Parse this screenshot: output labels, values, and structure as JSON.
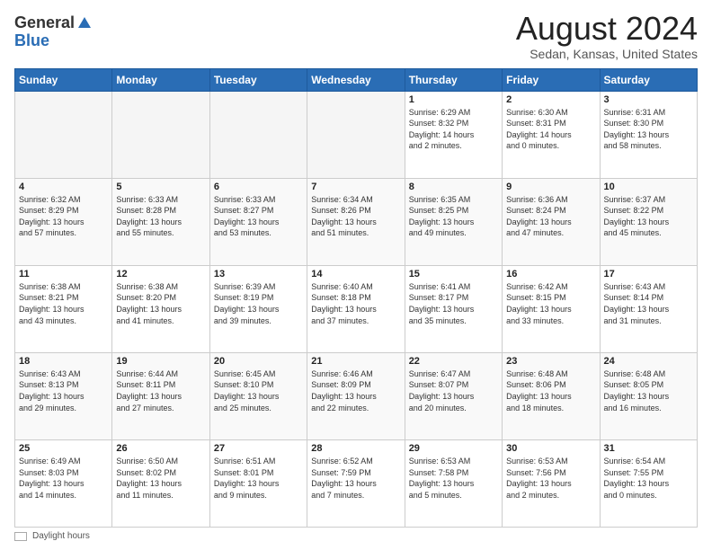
{
  "header": {
    "logo_general": "General",
    "logo_blue": "Blue",
    "month_title": "August 2024",
    "location": "Sedan, Kansas, United States"
  },
  "weekdays": [
    "Sunday",
    "Monday",
    "Tuesday",
    "Wednesday",
    "Thursday",
    "Friday",
    "Saturday"
  ],
  "footer": {
    "label": "Daylight hours"
  },
  "weeks": [
    [
      {
        "day": "",
        "info": ""
      },
      {
        "day": "",
        "info": ""
      },
      {
        "day": "",
        "info": ""
      },
      {
        "day": "",
        "info": ""
      },
      {
        "day": "1",
        "info": "Sunrise: 6:29 AM\nSunset: 8:32 PM\nDaylight: 14 hours\nand 2 minutes."
      },
      {
        "day": "2",
        "info": "Sunrise: 6:30 AM\nSunset: 8:31 PM\nDaylight: 14 hours\nand 0 minutes."
      },
      {
        "day": "3",
        "info": "Sunrise: 6:31 AM\nSunset: 8:30 PM\nDaylight: 13 hours\nand 58 minutes."
      }
    ],
    [
      {
        "day": "4",
        "info": "Sunrise: 6:32 AM\nSunset: 8:29 PM\nDaylight: 13 hours\nand 57 minutes."
      },
      {
        "day": "5",
        "info": "Sunrise: 6:33 AM\nSunset: 8:28 PM\nDaylight: 13 hours\nand 55 minutes."
      },
      {
        "day": "6",
        "info": "Sunrise: 6:33 AM\nSunset: 8:27 PM\nDaylight: 13 hours\nand 53 minutes."
      },
      {
        "day": "7",
        "info": "Sunrise: 6:34 AM\nSunset: 8:26 PM\nDaylight: 13 hours\nand 51 minutes."
      },
      {
        "day": "8",
        "info": "Sunrise: 6:35 AM\nSunset: 8:25 PM\nDaylight: 13 hours\nand 49 minutes."
      },
      {
        "day": "9",
        "info": "Sunrise: 6:36 AM\nSunset: 8:24 PM\nDaylight: 13 hours\nand 47 minutes."
      },
      {
        "day": "10",
        "info": "Sunrise: 6:37 AM\nSunset: 8:22 PM\nDaylight: 13 hours\nand 45 minutes."
      }
    ],
    [
      {
        "day": "11",
        "info": "Sunrise: 6:38 AM\nSunset: 8:21 PM\nDaylight: 13 hours\nand 43 minutes."
      },
      {
        "day": "12",
        "info": "Sunrise: 6:38 AM\nSunset: 8:20 PM\nDaylight: 13 hours\nand 41 minutes."
      },
      {
        "day": "13",
        "info": "Sunrise: 6:39 AM\nSunset: 8:19 PM\nDaylight: 13 hours\nand 39 minutes."
      },
      {
        "day": "14",
        "info": "Sunrise: 6:40 AM\nSunset: 8:18 PM\nDaylight: 13 hours\nand 37 minutes."
      },
      {
        "day": "15",
        "info": "Sunrise: 6:41 AM\nSunset: 8:17 PM\nDaylight: 13 hours\nand 35 minutes."
      },
      {
        "day": "16",
        "info": "Sunrise: 6:42 AM\nSunset: 8:15 PM\nDaylight: 13 hours\nand 33 minutes."
      },
      {
        "day": "17",
        "info": "Sunrise: 6:43 AM\nSunset: 8:14 PM\nDaylight: 13 hours\nand 31 minutes."
      }
    ],
    [
      {
        "day": "18",
        "info": "Sunrise: 6:43 AM\nSunset: 8:13 PM\nDaylight: 13 hours\nand 29 minutes."
      },
      {
        "day": "19",
        "info": "Sunrise: 6:44 AM\nSunset: 8:11 PM\nDaylight: 13 hours\nand 27 minutes."
      },
      {
        "day": "20",
        "info": "Sunrise: 6:45 AM\nSunset: 8:10 PM\nDaylight: 13 hours\nand 25 minutes."
      },
      {
        "day": "21",
        "info": "Sunrise: 6:46 AM\nSunset: 8:09 PM\nDaylight: 13 hours\nand 22 minutes."
      },
      {
        "day": "22",
        "info": "Sunrise: 6:47 AM\nSunset: 8:07 PM\nDaylight: 13 hours\nand 20 minutes."
      },
      {
        "day": "23",
        "info": "Sunrise: 6:48 AM\nSunset: 8:06 PM\nDaylight: 13 hours\nand 18 minutes."
      },
      {
        "day": "24",
        "info": "Sunrise: 6:48 AM\nSunset: 8:05 PM\nDaylight: 13 hours\nand 16 minutes."
      }
    ],
    [
      {
        "day": "25",
        "info": "Sunrise: 6:49 AM\nSunset: 8:03 PM\nDaylight: 13 hours\nand 14 minutes."
      },
      {
        "day": "26",
        "info": "Sunrise: 6:50 AM\nSunset: 8:02 PM\nDaylight: 13 hours\nand 11 minutes."
      },
      {
        "day": "27",
        "info": "Sunrise: 6:51 AM\nSunset: 8:01 PM\nDaylight: 13 hours\nand 9 minutes."
      },
      {
        "day": "28",
        "info": "Sunrise: 6:52 AM\nSunset: 7:59 PM\nDaylight: 13 hours\nand 7 minutes."
      },
      {
        "day": "29",
        "info": "Sunrise: 6:53 AM\nSunset: 7:58 PM\nDaylight: 13 hours\nand 5 minutes."
      },
      {
        "day": "30",
        "info": "Sunrise: 6:53 AM\nSunset: 7:56 PM\nDaylight: 13 hours\nand 2 minutes."
      },
      {
        "day": "31",
        "info": "Sunrise: 6:54 AM\nSunset: 7:55 PM\nDaylight: 13 hours\nand 0 minutes."
      }
    ]
  ]
}
